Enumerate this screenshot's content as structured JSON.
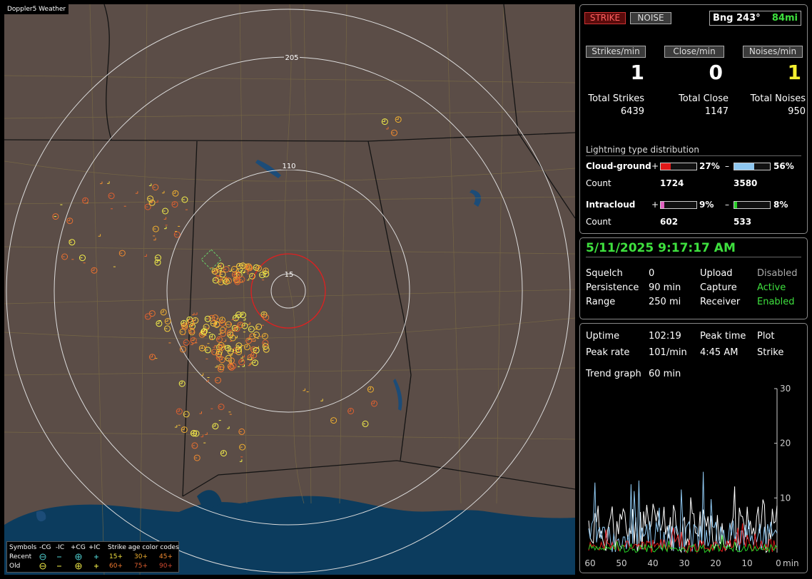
{
  "app": {
    "title": "Doppler5 Weather"
  },
  "map": {
    "range_labels": [
      "205",
      "110",
      "15"
    ],
    "colors": {
      "land": "#5b4d47",
      "sea": "#0c3c5e",
      "ring": "#dcdcdc",
      "close_ring": "#e02020",
      "county": "#8a7a40",
      "state": "#111111"
    }
  },
  "legend": {
    "symbols_label": "Symbols",
    "col_minus_cg": "-CG",
    "col_minus_ic": "-IC",
    "col_plus_cg": "+CG",
    "col_plus_ic": "+IC",
    "age_title": "Strike age color codes",
    "recent_label": "Recent",
    "old_label": "Old",
    "ages_recent": [
      "15+",
      "30+",
      "45+"
    ],
    "ages_old": [
      "60+",
      "75+",
      "90+"
    ]
  },
  "status": {
    "strike_label": "STRIKE",
    "noise_label": "NOISE",
    "bearing_label": "Bng 243°",
    "distance_label": "84mi",
    "rate_labels": [
      "Strikes/min",
      "Close/min",
      "Noises/min"
    ],
    "rate_values": [
      "1",
      "0",
      "1"
    ],
    "total_labels": [
      "Total Strikes",
      "Total Close",
      "Total Noises"
    ],
    "total_values": [
      "6439",
      "1147",
      "950"
    ]
  },
  "distribution": {
    "title": "Lightning type distribution",
    "cg_label": "Cloud-ground",
    "ic_label": "Intracloud",
    "count_label": "Count",
    "plus_sign": "+",
    "minus_sign": "–",
    "cg_pos_pct": "27%",
    "cg_neg_pct": "56%",
    "cg_pos_count": "1724",
    "cg_neg_count": "3580",
    "ic_pos_pct": "9%",
    "ic_neg_pct": "8%",
    "ic_pos_count": "602",
    "ic_neg_count": "533",
    "cg_pos_fill": 0.27,
    "cg_neg_fill": 0.56,
    "ic_pos_fill": 0.09,
    "ic_neg_fill": 0.08
  },
  "settings": {
    "datetime": "5/11/2025 9:17:17 AM",
    "squelch_label": "Squelch",
    "squelch_value": "0",
    "persistence_label": "Persistence",
    "persistence_value": "90 min",
    "range_label": "Range",
    "range_value": "250 mi",
    "upload_label": "Upload",
    "upload_value": "Disabled",
    "capture_label": "Capture",
    "capture_value": "Active",
    "receiver_label": "Receiver",
    "receiver_value": "Enabled"
  },
  "trend": {
    "uptime_label": "Uptime",
    "uptime_value": "102:19",
    "peak_time_label": "Peak time",
    "peak_time_value": "4:45 AM",
    "plot_label": "Plot",
    "plot_value": "Strike",
    "peak_rate_label": "Peak rate",
    "peak_rate_value": "101/min",
    "trend_label": "Trend graph",
    "trend_value": "60 min",
    "y_ticks": [
      "30",
      "20",
      "10"
    ],
    "x_ticks": [
      "60",
      "50",
      "40",
      "30",
      "20",
      "10",
      "0"
    ],
    "x_unit": "min"
  }
}
